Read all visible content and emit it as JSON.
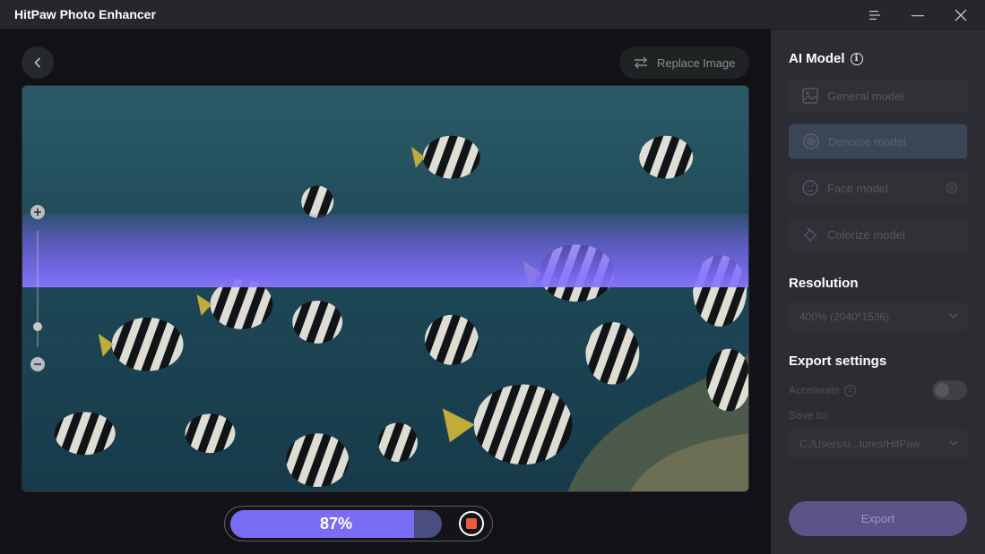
{
  "app": {
    "title": "HitPaw Photo Enhancer"
  },
  "toolbar": {
    "replace_label": "Replace Image"
  },
  "progress": {
    "percent": 87,
    "label": "87%"
  },
  "panel": {
    "ai_model": {
      "title": "AI Model",
      "models": [
        {
          "label": "General model",
          "icon": "image-icon",
          "selected": false
        },
        {
          "label": "Denoise model",
          "icon": "denoise-icon",
          "selected": true
        },
        {
          "label": "Face model",
          "icon": "face-icon",
          "selected": false,
          "has_settings": true
        },
        {
          "label": "Colorize model",
          "icon": "paint-bucket-icon",
          "selected": false
        }
      ]
    },
    "resolution": {
      "title": "Resolution",
      "value": "400% (2040*1536)"
    },
    "export_settings": {
      "title": "Export settings",
      "accelerate_label": "Accelerate",
      "accelerate_on": false,
      "save_to_label": "Save to:",
      "save_path": "C:/Users/u...tures/HitPaw"
    },
    "export_label": "Export"
  },
  "colors": {
    "accent": "#7b6cf6",
    "stop": "#ea5a3d",
    "panel_bg": "#2c2d33",
    "export_btn": "#5b5488"
  }
}
